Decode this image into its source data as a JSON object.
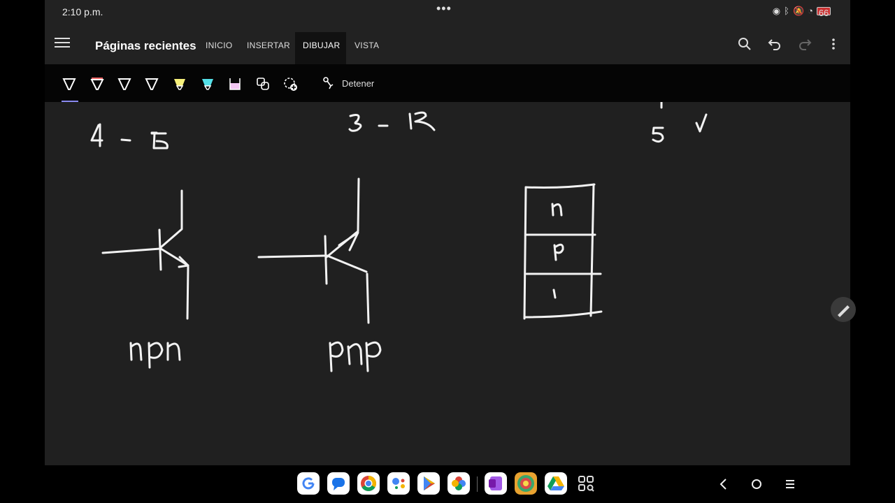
{
  "status_bar": {
    "time": "2:10 p.m.",
    "more": "•••",
    "battery": "66"
  },
  "header": {
    "title": "Páginas recientes",
    "tabs": [
      "INICIO",
      "INSERTAR",
      "DIBUJAR",
      "VISTA"
    ],
    "active_tab": "DIBUJAR"
  },
  "draw_toolbar": {
    "pens": [
      {
        "name": "pen-white",
        "color": "#ffffff"
      },
      {
        "name": "pen-red",
        "color": "#ff6a6a"
      },
      {
        "name": "pen-white-2",
        "color": "#ffffff"
      },
      {
        "name": "pen-white-3",
        "color": "#ffffff"
      },
      {
        "name": "highlighter-yellow",
        "color": "#f6f07a"
      },
      {
        "name": "highlighter-cyan",
        "color": "#54e0e8"
      },
      {
        "name": "highlighter-pink",
        "color": "#f2c6f2"
      }
    ],
    "stop_label": "Detener"
  },
  "canvas": {
    "notes": {
      "range_a": "4 - 6",
      "range_b": "3 - 18",
      "check": "5 ✓",
      "npn_label": "npn",
      "pnp_label": "pnp",
      "layers": [
        "n",
        "p",
        "1"
      ]
    }
  },
  "colors": {
    "accent_underline": "#8a8af0",
    "canvas_bg": "#202020",
    "toolbar_bg": "#222222"
  }
}
